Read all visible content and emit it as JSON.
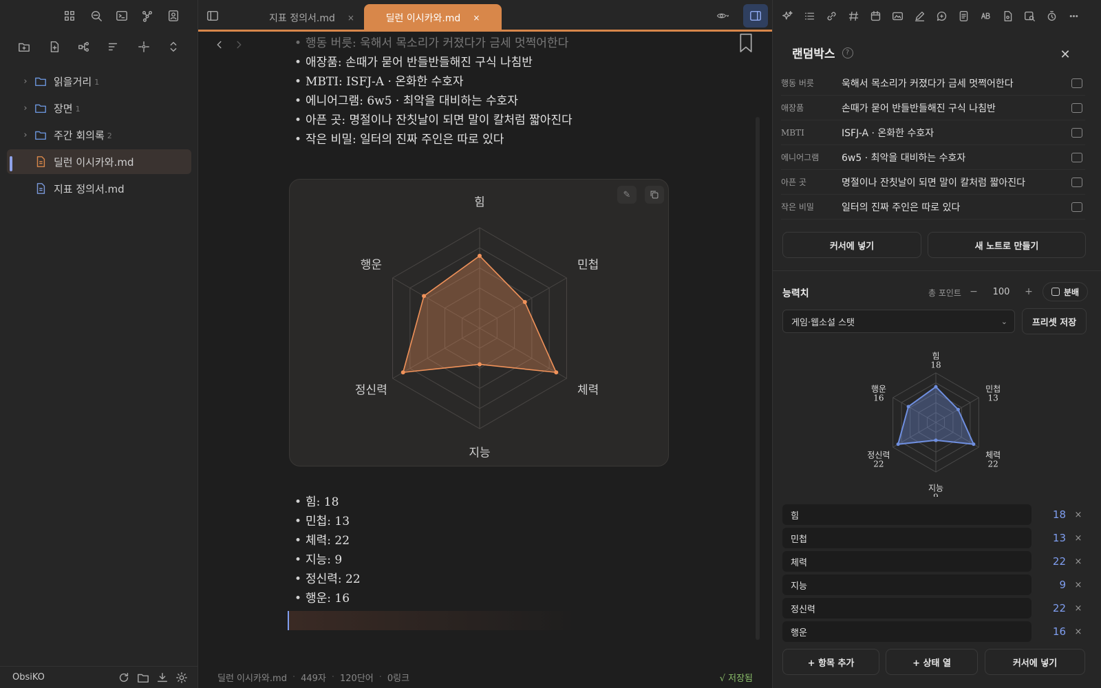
{
  "left": {
    "tree": [
      {
        "type": "folder",
        "name": "읽을거리",
        "count": "1"
      },
      {
        "type": "folder",
        "name": "장면",
        "count": "1"
      },
      {
        "type": "folder",
        "name": "주간 회의록",
        "count": "2"
      },
      {
        "type": "file",
        "name": "딜런 이시카와.md",
        "active": true
      },
      {
        "type": "file",
        "name": "지표 정의서.md"
      }
    ],
    "vault_name": "ObsiKO"
  },
  "tabs": [
    {
      "label": "지표 정의서.md",
      "active": false
    },
    {
      "label": "딜런 이시카와.md",
      "active": true
    }
  ],
  "note": {
    "top_list": [
      "행동 버릇: 욱해서 목소리가 커졌다가 금세 멋쩍어한다",
      "애장품: 손때가 묻어 반들반들해진 구식 나침반",
      "MBTI: ISFJ-A · 온화한 수호자",
      "에니어그램: 6w5 · 최악을 대비하는 수호자",
      "아픈 곳: 명절이나 잔칫날이 되면 말이 칼처럼 짧아진다",
      "작은 비밀: 일터의 진짜 주인은 따로 있다"
    ],
    "stat_list": [
      "힘: 18",
      "민첩: 13",
      "체력: 22",
      "지능: 9",
      "정신력: 22",
      "행운: 16"
    ],
    "edit_icon": "✎"
  },
  "statusbar": {
    "file": "딜런 이시카와.md",
    "chars": "449자",
    "words": "120단어",
    "links": "0링크",
    "saved": "√ 저장됨"
  },
  "panel": {
    "title": "랜덤박스",
    "rows": [
      {
        "k": "행동 버릇",
        "v": "욱해서 목소리가 커졌다가 금세 멋쩍어한다"
      },
      {
        "k": "애장품",
        "v": "손때가 묻어 반들반들해진 구식 나침반"
      },
      {
        "k": "MBTI",
        "v": "ISFJ-A · 온화한 수호자"
      },
      {
        "k": "에니어그램",
        "v": "6w5 · 최악을 대비하는 수호자"
      },
      {
        "k": "아픈 곳",
        "v": "명절이나 잔칫날이 되면 말이 칼처럼 짧아진다"
      },
      {
        "k": "작은 비밀",
        "v": "일터의 진짜 주인은 따로 있다"
      }
    ],
    "insert_btn": "커서에 넣기",
    "new_note_btn": "새 노트로 만들기",
    "ability_title": "능력치",
    "total_label": "총 포인트",
    "minus": "−",
    "total": "100",
    "plus": "+",
    "distribute": "분배",
    "preset": "게임·웹소설 스탯",
    "save_preset": "프리셋 저장",
    "add_item": "+ 항목 추가",
    "status_col": "+ 상태 열",
    "insert_btn2": "커서에 넣기",
    "remove_label": "×"
  },
  "chart_data": [
    {
      "type": "radar",
      "categories": [
        "힘",
        "민첩",
        "체력",
        "지능",
        "정신력",
        "행운"
      ],
      "values": [
        18,
        13,
        22,
        9,
        22,
        16
      ],
      "color": "#f0925a"
    },
    {
      "type": "radar",
      "categories": [
        "힘",
        "민첩",
        "체력",
        "지능",
        "정신력",
        "행운"
      ],
      "values": [
        18,
        13,
        22,
        9,
        22,
        16
      ],
      "color": "#6f8fe0"
    }
  ],
  "stats": [
    {
      "name": "힘",
      "value": "18"
    },
    {
      "name": "민첩",
      "value": "13"
    },
    {
      "name": "체력",
      "value": "22"
    },
    {
      "name": "지능",
      "value": "9"
    },
    {
      "name": "정신력",
      "value": "22"
    },
    {
      "name": "행운",
      "value": "16"
    }
  ],
  "colors": {
    "accent": "#d8874a",
    "blue": "#7f9ef0"
  }
}
